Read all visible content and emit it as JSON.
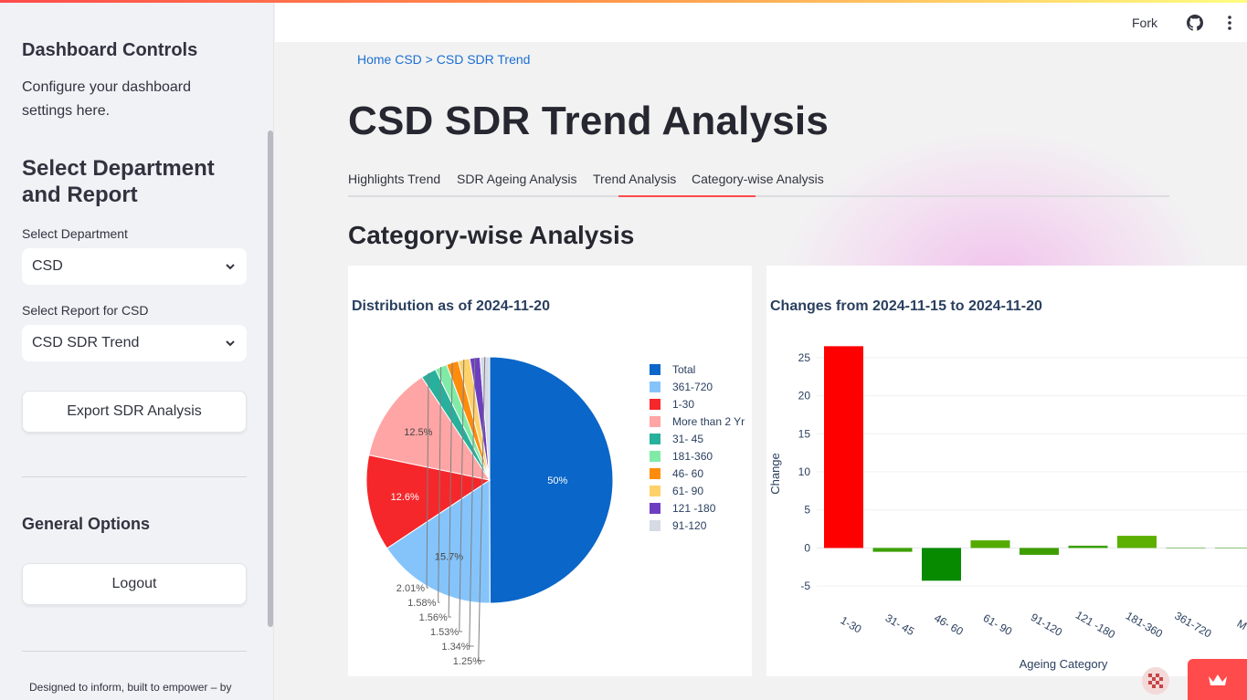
{
  "sidebar": {
    "title": "Dashboard Controls",
    "description": "Configure your dashboard settings here.",
    "section_title": "Select Department and Report",
    "department_label": "Select Department",
    "department_value": "CSD",
    "report_label": "Select Report for CSD",
    "report_value": "CSD SDR Trend",
    "export_button": "Export SDR Analysis",
    "general_title": "General Options",
    "logout_button": "Logout",
    "footer": "Designed to inform, built to empower – by"
  },
  "header": {
    "fork_label": "Fork"
  },
  "breadcrumb": "Home CSD > CSD SDR Trend",
  "page_title": "CSD SDR Trend Analysis",
  "tabs": [
    {
      "label": "Highlights Trend"
    },
    {
      "label": "SDR Ageing Analysis"
    },
    {
      "label": "Trend Analysis"
    },
    {
      "label": "Category-wise Analysis",
      "active": true
    }
  ],
  "section_title": "Category-wise Analysis",
  "chart_data": [
    {
      "type": "pie",
      "title": "Distribution as of 2024-11-20",
      "labels": [
        "Total",
        "361-720",
        "1-30",
        "More than 2 Yr",
        "31- 45",
        "181-360",
        "46- 60",
        "61- 90",
        "121 -180",
        "91-120"
      ],
      "values": [
        50,
        15.7,
        12.6,
        12.5,
        2.01,
        1.58,
        1.56,
        1.53,
        1.34,
        1.25
      ],
      "value_labels": [
        "50%",
        "15.7%",
        "12.6%",
        "12.5%",
        "2.01%",
        "1.58%",
        "1.56%",
        "1.53%",
        "1.34%",
        "1.25%"
      ],
      "colors": [
        "#0a66c8",
        "#85c4fb",
        "#f5272b",
        "#ffa5a5",
        "#27b09c",
        "#80eba7",
        "#ff8c0a",
        "#ffd16a",
        "#6d3fc0",
        "#d5dae5"
      ],
      "legend_position": "right"
    },
    {
      "type": "bar",
      "title": "Changes from 2024-11-15 to 2024-11-20",
      "xlabel": "Ageing Category",
      "ylabel": "Change",
      "categories": [
        "1-30",
        "31- 45",
        "46- 60",
        "61- 90",
        "91-120",
        "121 -180",
        "181-360",
        "361-720",
        "M"
      ],
      "values": [
        26.5,
        -0.5,
        -4.3,
        1.0,
        -0.9,
        0.3,
        1.6,
        0,
        0
      ],
      "colors": [
        "#ff0000",
        "#3aa000",
        "#088a00",
        "#55aa00",
        "#3e9e00",
        "#3aa000",
        "#5bb000",
        "#3aa000",
        "#3aa000"
      ],
      "yticks": [
        -5,
        0,
        5,
        10,
        15,
        20,
        25
      ],
      "ylim": [
        -7.5,
        27.5
      ],
      "grid": true
    }
  ]
}
